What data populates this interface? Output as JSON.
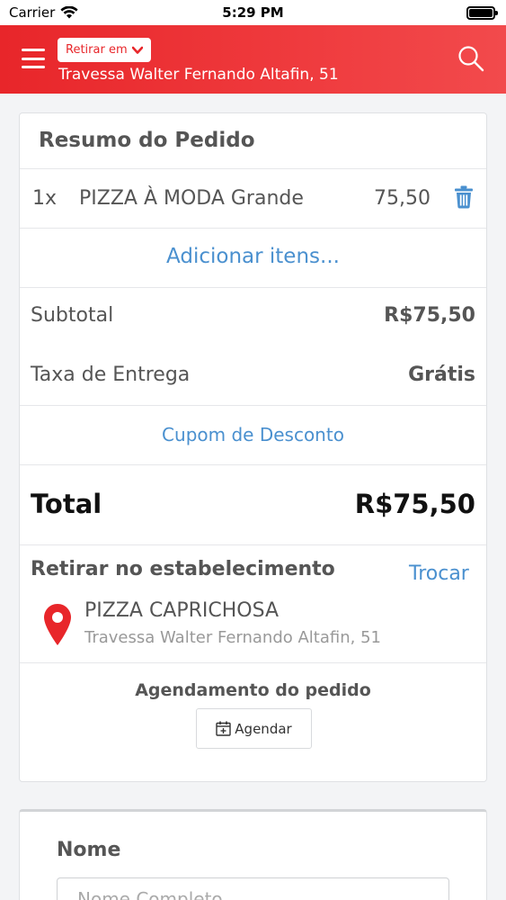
{
  "status_bar": {
    "carrier": "Carrier",
    "time": "5:29 PM"
  },
  "header": {
    "pickup_badge": "Retirar em",
    "address": "Travessa Walter Fernando Altafin, 51"
  },
  "order_summary": {
    "title": "Resumo do Pedido",
    "items": [
      {
        "qty": "1x",
        "name": "PIZZA À MODA Grande",
        "price": "75,50"
      }
    ],
    "add_items_label": "Adicionar itens...",
    "subtotal_label": "Subtotal",
    "subtotal_value": "R$75,50",
    "delivery_label": "Taxa de Entrega",
    "delivery_value": "Grátis",
    "coupon_label": "Cupom de Desconto",
    "total_label": "Total",
    "total_value": "R$75,50"
  },
  "pickup": {
    "title": "Retirar no estabelecimento",
    "change_label": "Trocar",
    "store_name": "PIZZA CAPRICHOSA",
    "store_address": "Travessa Walter Fernando Altafin, 51"
  },
  "schedule": {
    "title": "Agendamento do pedido",
    "button_label": "Agendar"
  },
  "customer_form": {
    "name_label": "Nome",
    "name_placeholder": "Nome Completo"
  },
  "colors": {
    "brand_red": "#e8262a",
    "link_blue": "#4a90cf"
  }
}
